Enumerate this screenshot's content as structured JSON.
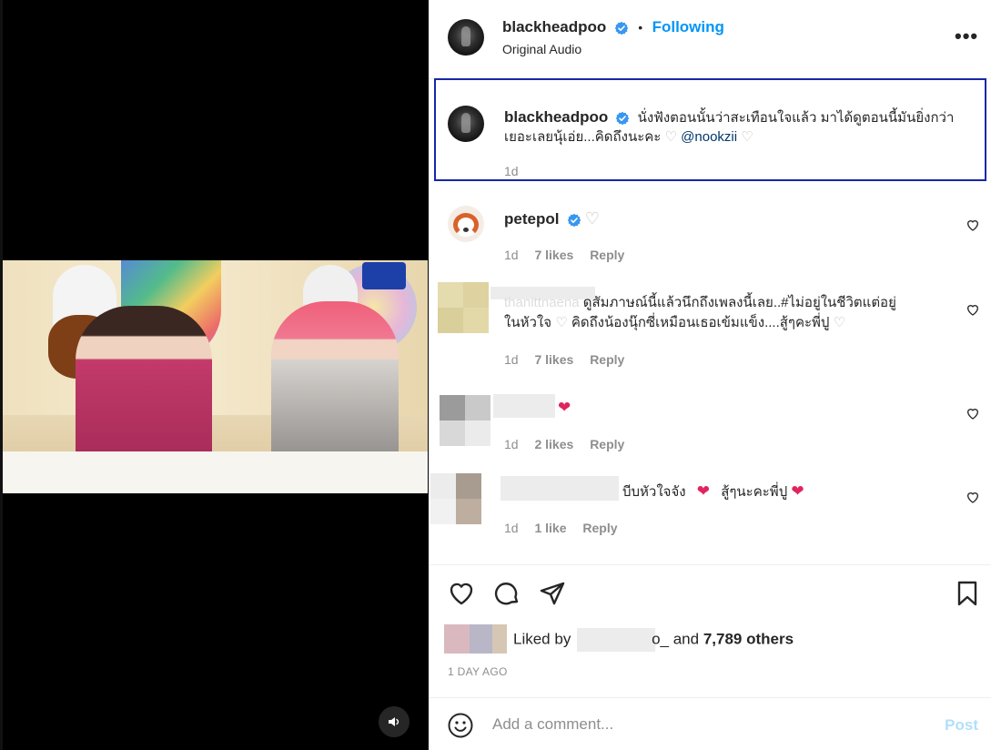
{
  "header": {
    "username": "blackheadpoo",
    "follow_status": "Following",
    "dot": "•",
    "audio": "Original Audio",
    "more": "•••"
  },
  "caption": {
    "username": "blackheadpoo",
    "text": "นั่งฟังตอนนั้นว่าสะเทือนใจแล้ว มาได้ดูตอนนี้มันยิ่งกว่า",
    "text_line2": "เยอะเลยนุ้เอ่ย...คิดถึงนะคะ",
    "mention": "@nookzii",
    "time": "1d"
  },
  "comments": [
    {
      "username": "petepol",
      "text": "",
      "time": "1d",
      "likes": "7 likes",
      "reply": "Reply"
    },
    {
      "username": "thanittnaena",
      "text": "ดูสัมภาษณ์นี้แล้วนึกถึงเพลงนี้เลย..#ไม่อยู่ในชีวิตแต่อยู่",
      "text_line2": "ในหัวใจ",
      "text_line2b": "คิดถึงน้องนุ๊กซี่เหมือนเธอเข้มแข็ง....สู้ๆคะพี่ปู",
      "time": "1d",
      "likes": "7 likes",
      "reply": "Reply"
    },
    {
      "username": "",
      "text": "",
      "time": "1d",
      "likes": "2 likes",
      "reply": "Reply"
    },
    {
      "username": "",
      "text": "บีบหัวใจจัง",
      "text_b": "สู้ๆนะคะพี่ปู",
      "time": "1d",
      "likes": "1 like",
      "reply": "Reply"
    }
  ],
  "likes_summary": {
    "prefix": "Liked by",
    "user_suffix": "o_",
    "and": "and",
    "count": "7,789 others"
  },
  "time_ago": "1 DAY AGO",
  "add_comment": {
    "placeholder": "Add a comment...",
    "post": "Post"
  },
  "colors": {
    "accent": "#0095f6",
    "verified": "#3897f0",
    "red_heart": "#ed4956",
    "highlight_border": "#1727a6"
  }
}
